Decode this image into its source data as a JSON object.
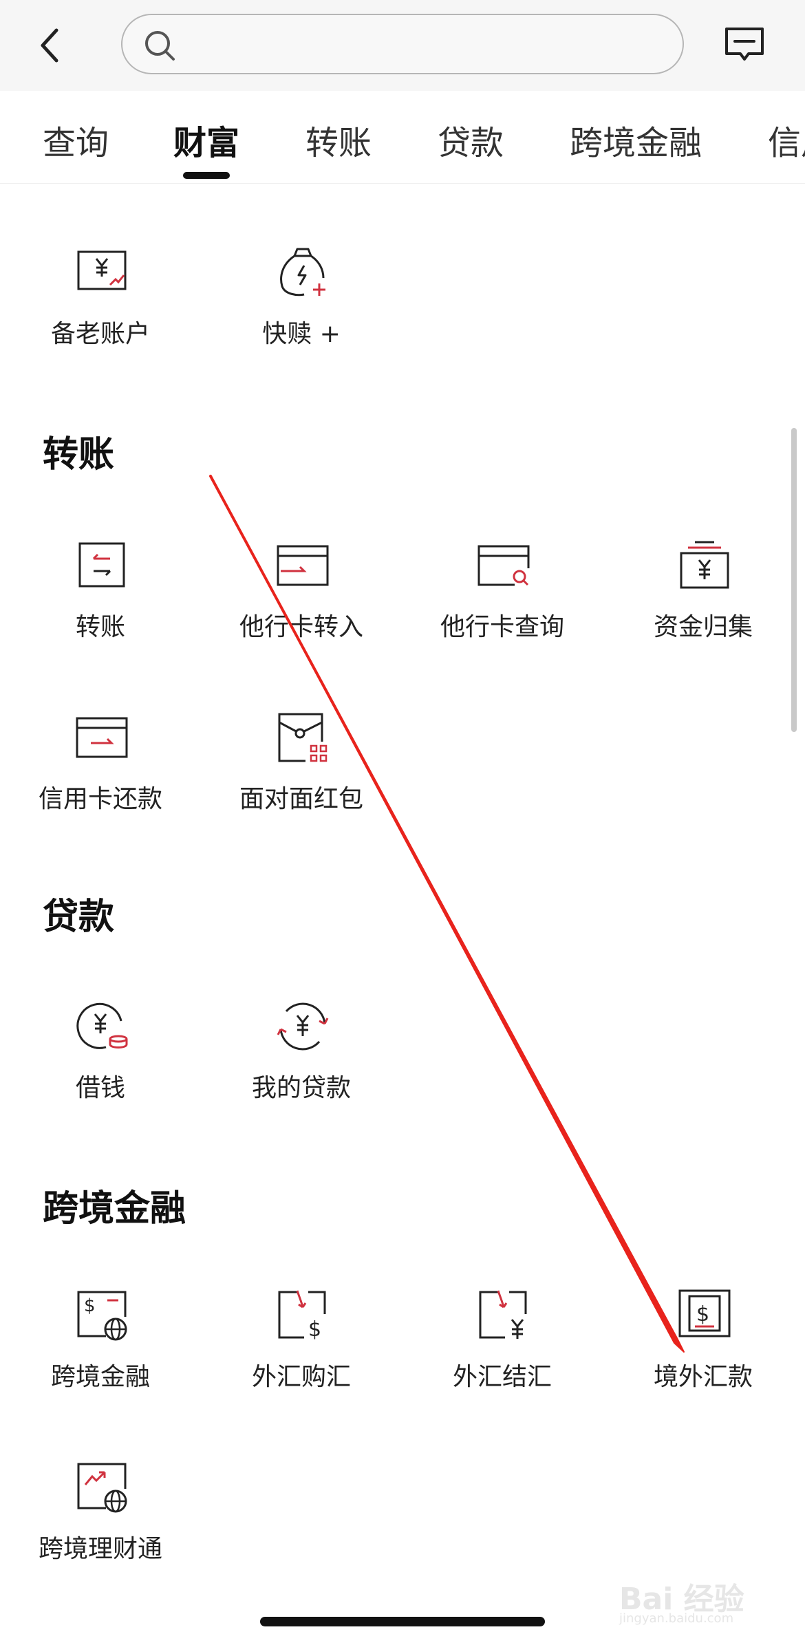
{
  "header": {
    "search_placeholder": ""
  },
  "tabs": [
    {
      "label": "查询"
    },
    {
      "label": "财富",
      "active": true
    },
    {
      "label": "转账"
    },
    {
      "label": "贷款"
    },
    {
      "label": "跨境金融"
    },
    {
      "label": "信用"
    }
  ],
  "wealth": {
    "items": [
      {
        "label": "备老账户",
        "icon": "pension-account-icon"
      },
      {
        "label": "快赎 +",
        "icon": "quick-redeem-icon"
      }
    ]
  },
  "transfer": {
    "title": "转账",
    "items": [
      {
        "label": "转账",
        "icon": "transfer-icon"
      },
      {
        "label": "他行卡转入",
        "icon": "card-transfer-in-icon"
      },
      {
        "label": "他行卡查询",
        "icon": "card-query-icon"
      },
      {
        "label": "资金归集",
        "icon": "fund-collection-icon"
      },
      {
        "label": "信用卡还款",
        "icon": "credit-card-repay-icon"
      },
      {
        "label": "面对面红包",
        "icon": "red-packet-qr-icon"
      }
    ]
  },
  "loan": {
    "title": "贷款",
    "items": [
      {
        "label": "借钱",
        "icon": "borrow-money-icon"
      },
      {
        "label": "我的贷款",
        "icon": "my-loan-icon"
      }
    ]
  },
  "crossborder": {
    "title": "跨境金融",
    "items": [
      {
        "label": "跨境金融",
        "icon": "crossborder-finance-icon"
      },
      {
        "label": "外汇购汇",
        "icon": "fx-purchase-icon"
      },
      {
        "label": "外汇结汇",
        "icon": "fx-settlement-icon"
      },
      {
        "label": "境外汇款",
        "icon": "overseas-remittance-icon"
      },
      {
        "label": "跨境理财通",
        "icon": "crossborder-wealth-icon"
      }
    ]
  },
  "colors": {
    "accent": "#d0323f",
    "annotation": "#e8231c",
    "text": "#222222",
    "icon_stroke": "#222222"
  },
  "watermark": {
    "text": "Bai 经验",
    "url": "jingyan.baidu.com"
  }
}
